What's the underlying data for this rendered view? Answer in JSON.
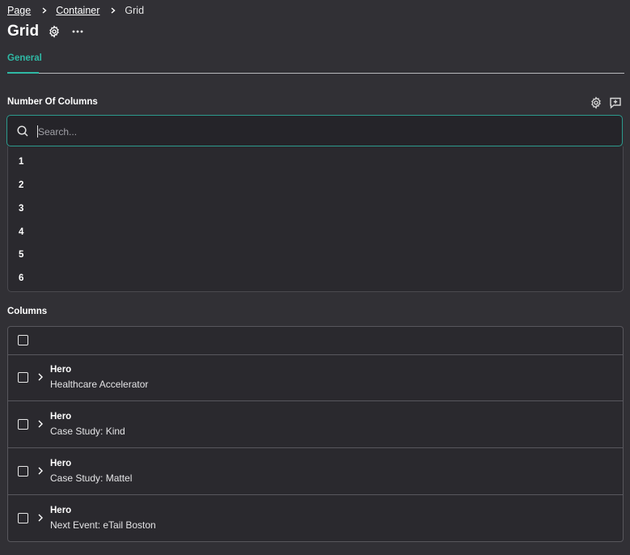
{
  "breadcrumb": {
    "items": [
      "Page",
      "Container"
    ],
    "current": "Grid"
  },
  "header": {
    "title": "Grid"
  },
  "tabs": [
    {
      "label": "General",
      "active": true
    }
  ],
  "accent_color": "#2fb9a5",
  "fields": {
    "number_of_columns": {
      "label": "Number Of Columns",
      "search_placeholder": "Search...",
      "options": [
        "1",
        "2",
        "3",
        "4",
        "5",
        "6"
      ]
    },
    "columns": {
      "label": "Columns",
      "rows": [
        {
          "type": "Hero",
          "name": "Healthcare Accelerator"
        },
        {
          "type": "Hero",
          "name": "Case Study: Kind"
        },
        {
          "type": "Hero",
          "name": "Case Study: Mattel"
        },
        {
          "type": "Hero",
          "name": "Next Event: eTail Boston"
        }
      ]
    }
  }
}
